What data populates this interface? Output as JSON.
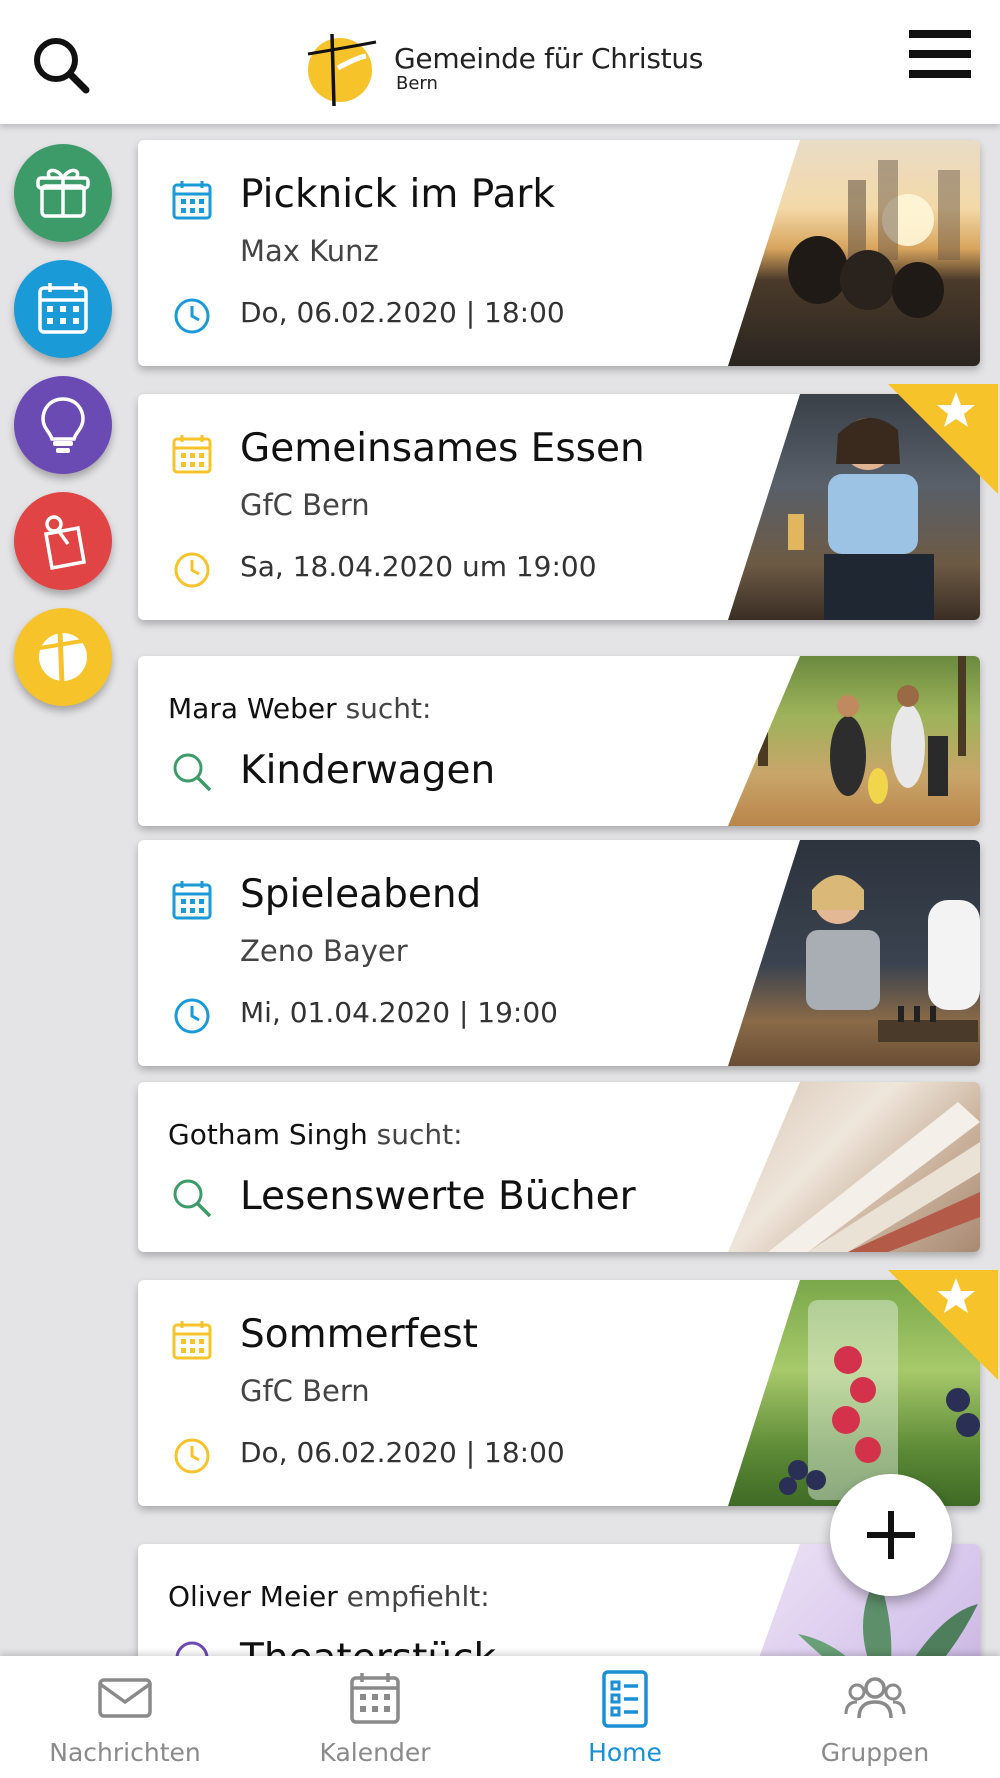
{
  "header": {
    "logo_title": "Gemeinde für Christus",
    "logo_subtitle": "Bern"
  },
  "side_menu": [
    {
      "icon": "gift-icon",
      "color": "#3d9a69"
    },
    {
      "icon": "calendar-icon",
      "color": "#1a9ad6"
    },
    {
      "icon": "lightbulb-icon",
      "color": "#6a4ab3"
    },
    {
      "icon": "pinned-note-icon",
      "color": "#e04444"
    },
    {
      "icon": "church-logo-icon",
      "color": "#f6c32a"
    }
  ],
  "cards": [
    {
      "type": "event",
      "title": "Picknick im Park",
      "organizer": "Max Kunz",
      "datetime": "Do, 06.02.2020 | 18:00",
      "accent": "#1a9ad6",
      "featured": false
    },
    {
      "type": "event",
      "title": "Gemeinsames Essen",
      "organizer": "GfC Bern",
      "datetime": "Sa, 18.04.2020 um 19:00",
      "accent": "#f6c32a",
      "featured": true
    },
    {
      "type": "search",
      "person": "Mara Weber",
      "verb": "sucht:",
      "title": "Kinderwagen",
      "accent": "#3d9a69"
    },
    {
      "type": "event",
      "title": "Spieleabend",
      "organizer": "Zeno Bayer",
      "datetime": "Mi, 01.04.2020 | 19:00",
      "accent": "#1a9ad6",
      "featured": false
    },
    {
      "type": "search",
      "person": "Gotham Singh",
      "verb": "sucht:",
      "title": "Lesenswerte Bücher",
      "accent": "#3d9a69"
    },
    {
      "type": "event",
      "title": "Sommerfest",
      "organizer": "GfC Bern",
      "datetime": "Do, 06.02.2020 | 18:00",
      "accent": "#f6c32a",
      "featured": true
    },
    {
      "type": "recommend",
      "person": "Oliver Meier",
      "verb": "empfiehlt:",
      "title": "Theaterstück",
      "accent": "#6a4ab3"
    }
  ],
  "bottom_nav": [
    {
      "label": "Nachrichten",
      "icon": "mail-icon",
      "active": false
    },
    {
      "label": "Kalender",
      "icon": "calendar-icon",
      "active": false
    },
    {
      "label": "Home",
      "icon": "list-icon",
      "active": true
    },
    {
      "label": "Gruppen",
      "icon": "group-icon",
      "active": false
    }
  ],
  "colors": {
    "active": "#1a8fd6",
    "inactive": "#8a8a8a",
    "brand_yellow": "#f6c32a"
  }
}
